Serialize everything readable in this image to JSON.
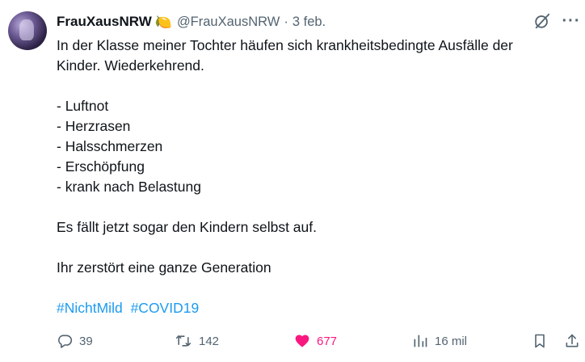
{
  "tweet": {
    "author_name": "FrauXausNRW",
    "author_emoji": "🍋",
    "handle": "@FrauXausNRW",
    "separator": "·",
    "date": "3 feb.",
    "lines": [
      "In der Klasse meiner Tochter häufen sich krankheitsbedingte Ausfälle der",
      "Kinder. Wiederkehrend."
    ],
    "list": [
      "- Luftnot",
      "- Herzrasen",
      "- Halsschmerzen",
      "- Erschöpfung",
      "- krank nach Belastung"
    ],
    "para2": "Es fällt jetzt sogar den Kindern selbst auf.",
    "para3": "Ihr zerstört eine ganze Generation",
    "hashtags": [
      "#NichtMild",
      "#COVID19"
    ]
  },
  "actions": {
    "replies": "39",
    "retweets": "142",
    "likes": "677",
    "views": "16 mil"
  },
  "icons": {
    "avatar": "avatar-image",
    "grok": "grok-icon",
    "more": "more-icon",
    "reply": "reply-icon",
    "retweet": "retweet-icon",
    "like": "heart-icon",
    "views": "views-icon",
    "bookmark": "bookmark-icon",
    "share": "share-icon"
  },
  "colors": {
    "text": "#0f1419",
    "secondary": "#536471",
    "link": "#1d9bf0",
    "like": "#f91880"
  }
}
